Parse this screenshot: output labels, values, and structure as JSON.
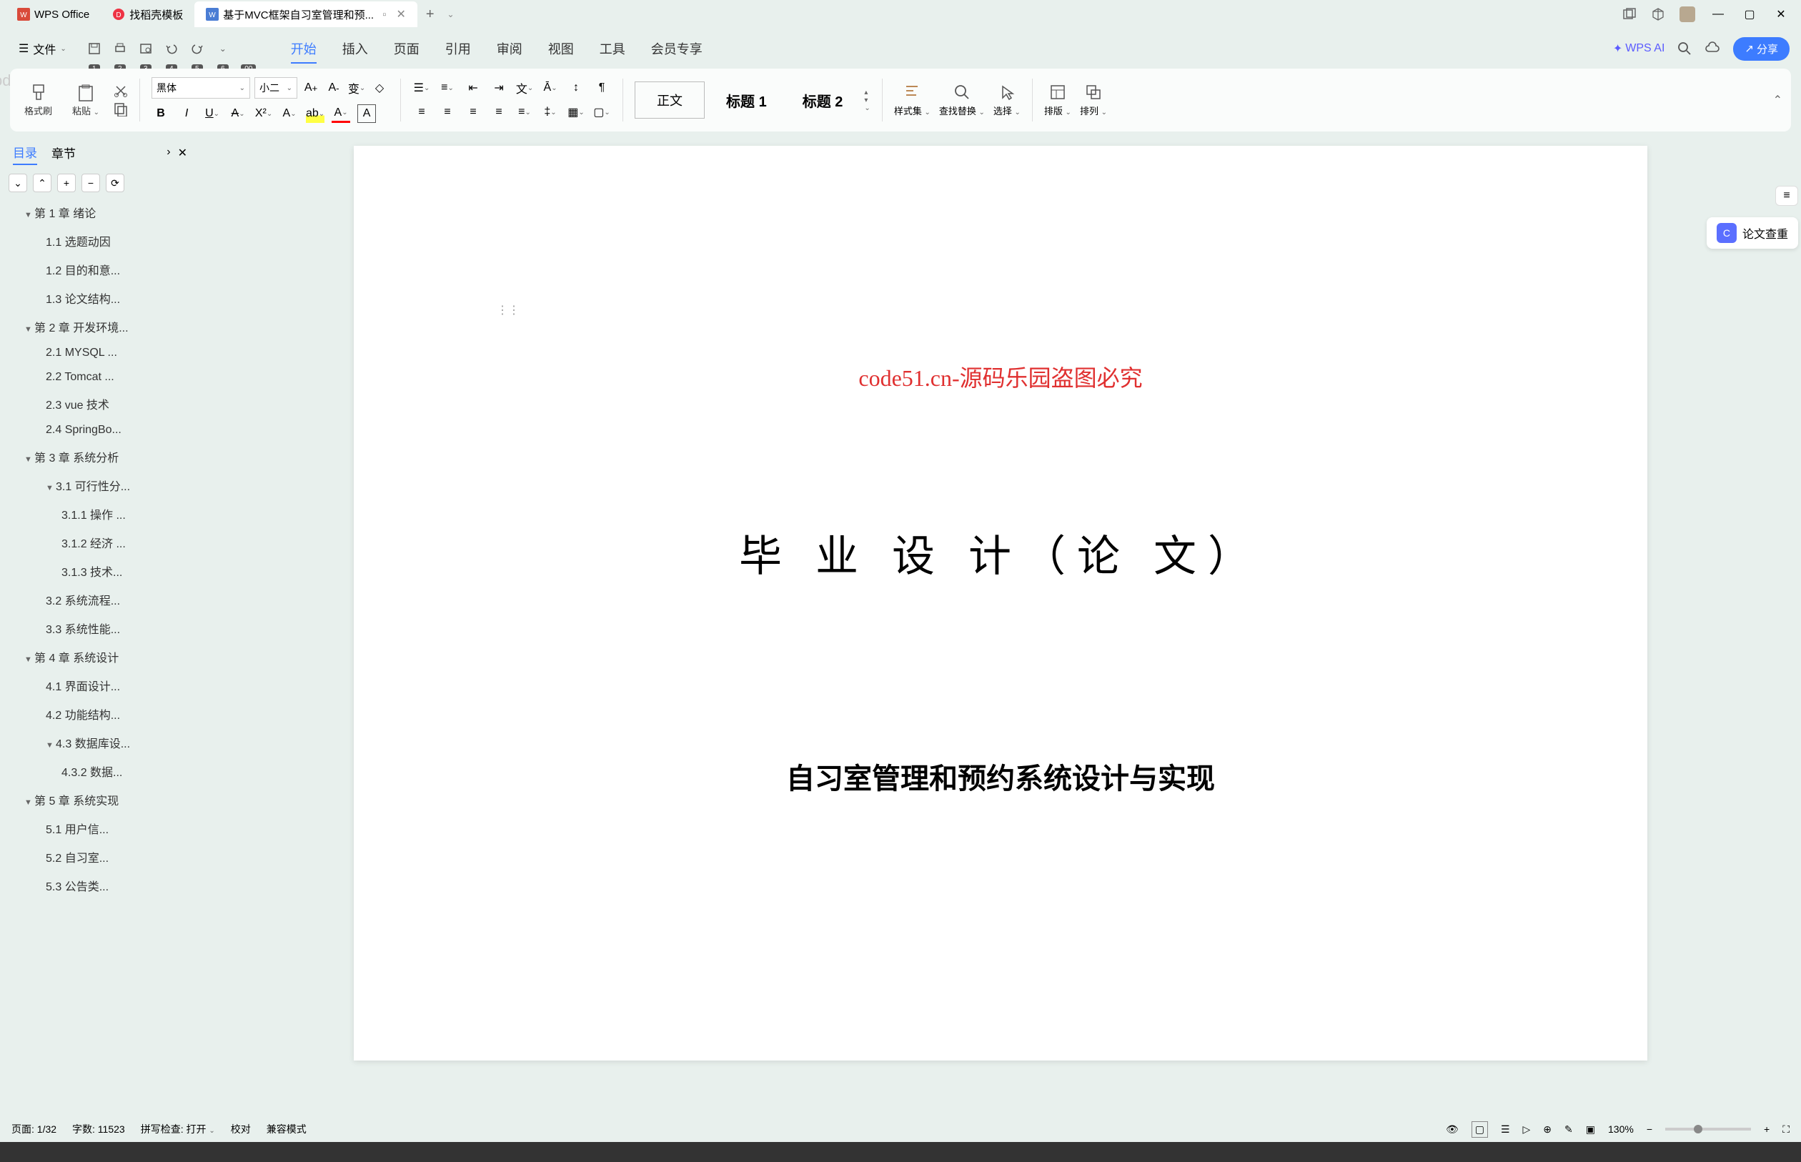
{
  "tabs": {
    "t1": "WPS Office",
    "t2": "找稻壳模板",
    "t3": "基于MVC框架自习室管理和预..."
  },
  "menu": {
    "file": "文件",
    "items": [
      "开始",
      "插入",
      "页面",
      "引用",
      "审阅",
      "视图",
      "工具",
      "会员专享"
    ],
    "keys": [
      "H",
      "N",
      "P",
      "S",
      "R",
      "W",
      "L",
      "K"
    ],
    "active": 0,
    "wpsai": "WPS AI",
    "share": "分享"
  },
  "file_key": "F",
  "quick_keys": [
    "1",
    "2",
    "3",
    "4",
    "5",
    "6",
    "00"
  ],
  "ribbon": {
    "brush": "格式刷",
    "paste": "粘贴",
    "font": "黑体",
    "size": "小二",
    "styles": {
      "body": "正文",
      "h1": "标题 1",
      "h2": "标题 2"
    },
    "styleset": "样式集",
    "findrep": "查找替换",
    "select": "选择",
    "layout": "排版",
    "arrange": "排列"
  },
  "sidebar": {
    "tab1": "目录",
    "tab2": "章节",
    "toc": [
      {
        "l": 1,
        "t": "第 1 章  绪论",
        "c": true
      },
      {
        "l": 2,
        "t": "1.1 选题动因"
      },
      {
        "l": 2,
        "t": "1.2 目的和意..."
      },
      {
        "l": 2,
        "t": "1.3 论文结构..."
      },
      {
        "l": 1,
        "t": "第 2 章  开发环境...",
        "c": true
      },
      {
        "l": 2,
        "t": "2.1 MYSQL ..."
      },
      {
        "l": 2,
        "t": "2.2 Tomcat ..."
      },
      {
        "l": 2,
        "t": "2.3 vue 技术"
      },
      {
        "l": 2,
        "t": "2.4 SpringBo..."
      },
      {
        "l": 1,
        "t": "第 3 章  系统分析",
        "c": true
      },
      {
        "l": 2,
        "t": "3.1 可行性分...",
        "c": true
      },
      {
        "l": 3,
        "t": "3.1.1 操作 ..."
      },
      {
        "l": 3,
        "t": "3.1.2 经济 ..."
      },
      {
        "l": 3,
        "t": "3.1.3 技术..."
      },
      {
        "l": 2,
        "t": "3.2 系统流程..."
      },
      {
        "l": 2,
        "t": "3.3 系统性能..."
      },
      {
        "l": 1,
        "t": "第 4 章  系统设计",
        "c": true
      },
      {
        "l": 2,
        "t": "4.1 界面设计..."
      },
      {
        "l": 2,
        "t": "4.2 功能结构..."
      },
      {
        "l": 2,
        "t": "4.3 数据库设...",
        "c": true
      },
      {
        "l": 3,
        "t": "4.3.2  数据..."
      },
      {
        "l": 1,
        "t": "第 5 章  系统实现",
        "c": true
      },
      {
        "l": 2,
        "t": "5.1 用户信..."
      },
      {
        "l": 2,
        "t": "5.2 自习室..."
      },
      {
        "l": 2,
        "t": "5.3 公告类..."
      }
    ]
  },
  "doc": {
    "watermark_red": "code51.cn-源码乐园盗图必究",
    "title": "毕 业 设 计（论 文）",
    "subtitle": "自习室管理和预约系统设计与实现"
  },
  "widgets": {
    "thesis": "论文查重"
  },
  "status": {
    "page": "页面: 1/32",
    "words": "字数: 11523",
    "spell": "拼写检查: 打开",
    "review": "校对",
    "compat": "兼容模式",
    "zoom": "130%"
  },
  "wm": "code51.cn"
}
